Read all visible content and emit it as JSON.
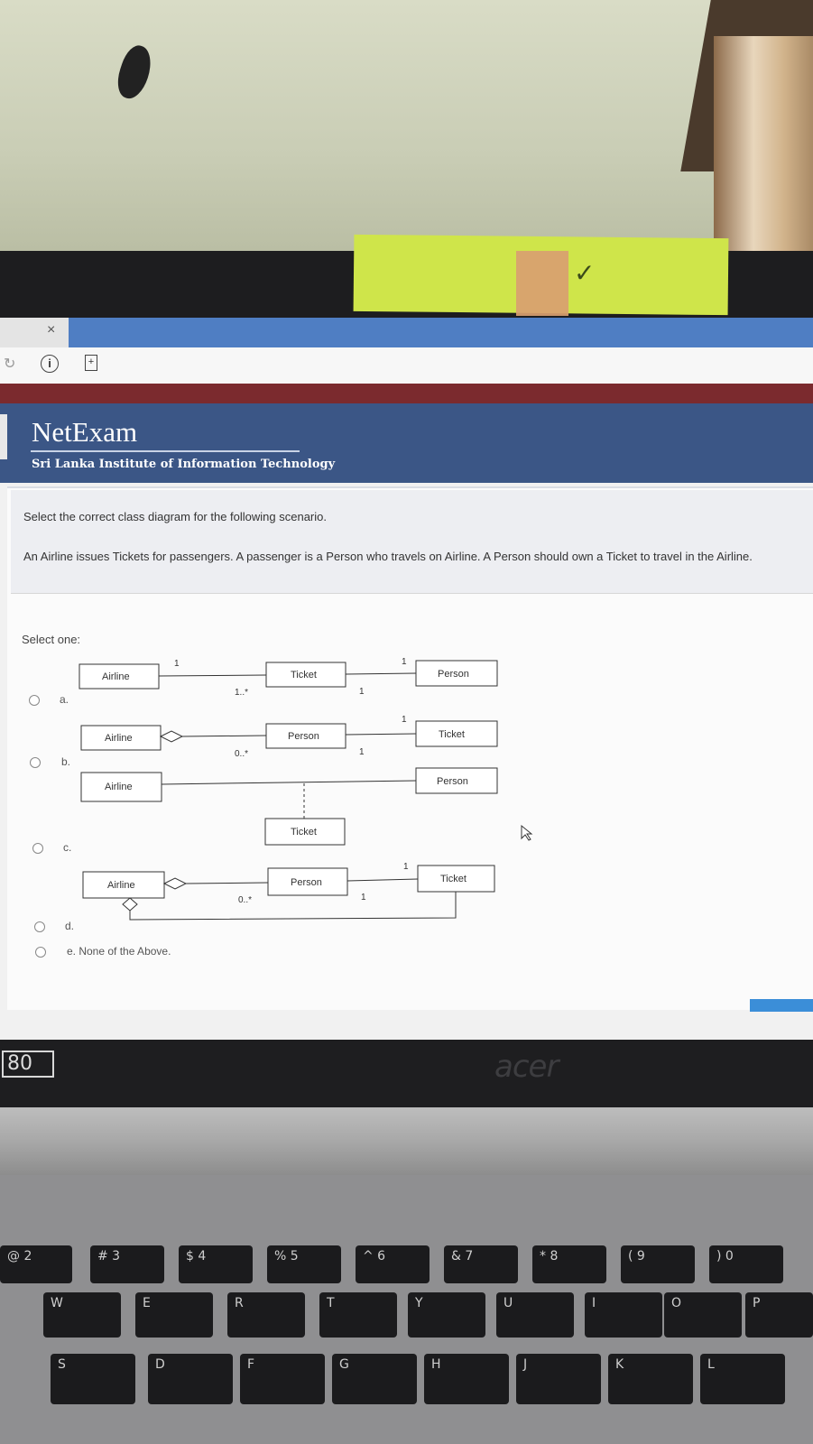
{
  "browser": {
    "tab_close": "×",
    "reload_icon": "↻",
    "info_icon": "i",
    "page_icon": "+"
  },
  "header": {
    "title": "NetExam",
    "subtitle": "Sri Lanka Institute of Information Technology"
  },
  "question": {
    "title": "Select the correct class diagram for the following scenario.",
    "scenario": "An Airline issues Tickets for passengers.  A passenger is a Person who travels on Airline.  A Person should own a Ticket to travel in the Airline.",
    "select_label": "Select one:",
    "options": [
      {
        "letter": "a.",
        "classes": [
          "Airline",
          "Ticket",
          "Person"
        ],
        "mult": [
          "1",
          "1..*",
          "1",
          "1"
        ]
      },
      {
        "letter": "b.",
        "classes": [
          "Airline",
          "Person",
          "Ticket"
        ],
        "mult": [
          "0..*",
          "1",
          "1"
        ]
      },
      {
        "letter": "c.",
        "classes": [
          "Airline",
          "Person",
          "Ticket"
        ]
      },
      {
        "letter": "d.",
        "classes": [
          "Airline",
          "Person",
          "Ticket"
        ],
        "mult": [
          "0..*",
          "1",
          "1"
        ]
      }
    ],
    "none_option": "e. None of the Above."
  },
  "laptop": {
    "sticker_text": "80",
    "brand": "acer"
  },
  "keyboard": {
    "row1": [
      "@\n2",
      "#\n3",
      "$\n4",
      "%\n5",
      "^\n6",
      "&\n7",
      "*\n8",
      "(\n9",
      ")\n0"
    ],
    "row2": [
      "W",
      "E",
      "R",
      "T",
      "Y",
      "U",
      "I",
      "O",
      "P"
    ],
    "row3": [
      "S",
      "D",
      "F",
      "G",
      "H",
      "J",
      "K",
      "L"
    ]
  },
  "colors": {
    "header_bg": "#3b5686",
    "maroon_bar": "#7b2a2e",
    "tab_accent": "#4f7ec3",
    "sticky_note": "#cfe54a"
  }
}
